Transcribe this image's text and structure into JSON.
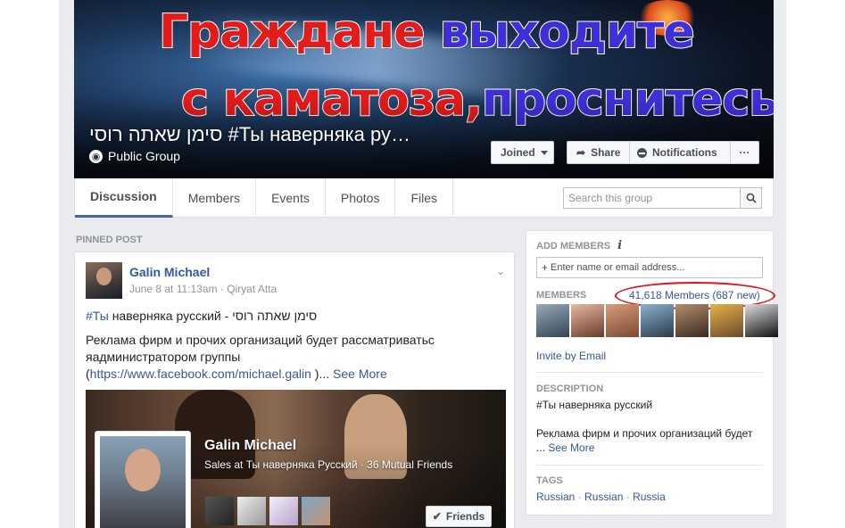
{
  "cover": {
    "line1_part1": "Граждане",
    "line1_part2": "выходите",
    "line2_part1": "с каматоза,",
    "line2_part2": "проснитесь"
  },
  "group": {
    "title": "סימן שאתה רוסי #Ты наверняка ру…",
    "privacy": "Public Group"
  },
  "actions": {
    "joined": "Joined",
    "share": "Share",
    "notifications": "Notifications",
    "more": "···"
  },
  "nav": {
    "tabs": [
      "Discussion",
      "Members",
      "Events",
      "Photos",
      "Files"
    ],
    "search_placeholder": "Search this group"
  },
  "post": {
    "section_label": "PINNED POST",
    "author": "Galin Michael",
    "date": "June 8 at 11:13am",
    "location": "Qiryat Atta",
    "line1_tag": "#Ты",
    "line1_rest": "наверняка русский - סימן שאתה רוסי",
    "line2": "Реклама фирм и прочих организаций будет рассматриватьс",
    "line3": "яадминистратором группы",
    "line4_open": "(",
    "line4_link": "https://www.facebook.com/michael.galin",
    "line4_close": " )...",
    "see_more": "See More",
    "card": {
      "name": "Galin Michael",
      "subtitle": "Sales at Ты наверняка Русский · 36 Mutual Friends",
      "friends_button": "Friends"
    }
  },
  "sidebar": {
    "add_members_heading": "ADD MEMBERS",
    "add_members_placeholder": "Enter name or email address...",
    "members_heading": "MEMBERS",
    "members_count": "41,618 Members (687 new)",
    "invite": "Invite by Email",
    "description_heading": "DESCRIPTION",
    "description_line1": "#Ты наверняка русский",
    "description_line2": "Реклама фирм и прочих организаций будет",
    "description_more_prefix": "...",
    "description_more": "See More",
    "tags_heading": "TAGS",
    "tags": [
      "Russian",
      "Russian",
      "Russia"
    ]
  }
}
